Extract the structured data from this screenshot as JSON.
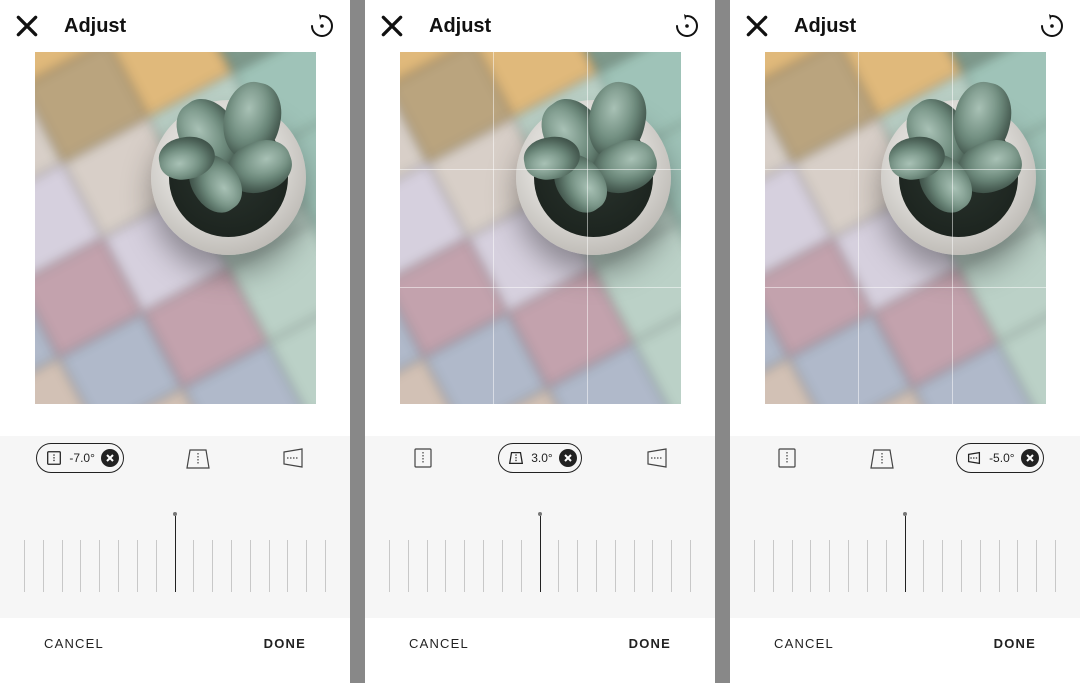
{
  "screens": [
    {
      "title": "Adjust",
      "active_mode_index": 0,
      "pill_value": "-7.0°",
      "pointer_pct": 50,
      "show_grid": false,
      "cancel_label": "CANCEL",
      "done_label": "DONE"
    },
    {
      "title": "Adjust",
      "active_mode_index": 1,
      "pill_value": "3.0°",
      "pointer_pct": 50,
      "show_grid": true,
      "cancel_label": "CANCEL",
      "done_label": "DONE"
    },
    {
      "title": "Adjust",
      "active_mode_index": 2,
      "pill_value": "-5.0°",
      "pointer_pct": 50,
      "show_grid": true,
      "cancel_label": "CANCEL",
      "done_label": "DONE"
    }
  ],
  "mode_icons": [
    "straighten-icon",
    "perspective-vertical-icon",
    "perspective-horizontal-icon"
  ],
  "tile_colors": [
    "c4",
    "c3",
    "c3",
    "c2",
    "c1",
    "c5",
    "c4",
    "c2",
    "c3",
    "c1",
    "c6",
    "c5",
    "c4",
    "c8",
    "c7",
    "c10",
    "c6",
    "c5",
    "c8",
    "c7",
    "c9",
    "c10",
    "c6",
    "c8",
    "c7",
    "c2",
    "c9",
    "c10",
    "c8",
    "c7",
    "c9",
    "c2",
    "c9",
    "c10",
    "c8"
  ]
}
